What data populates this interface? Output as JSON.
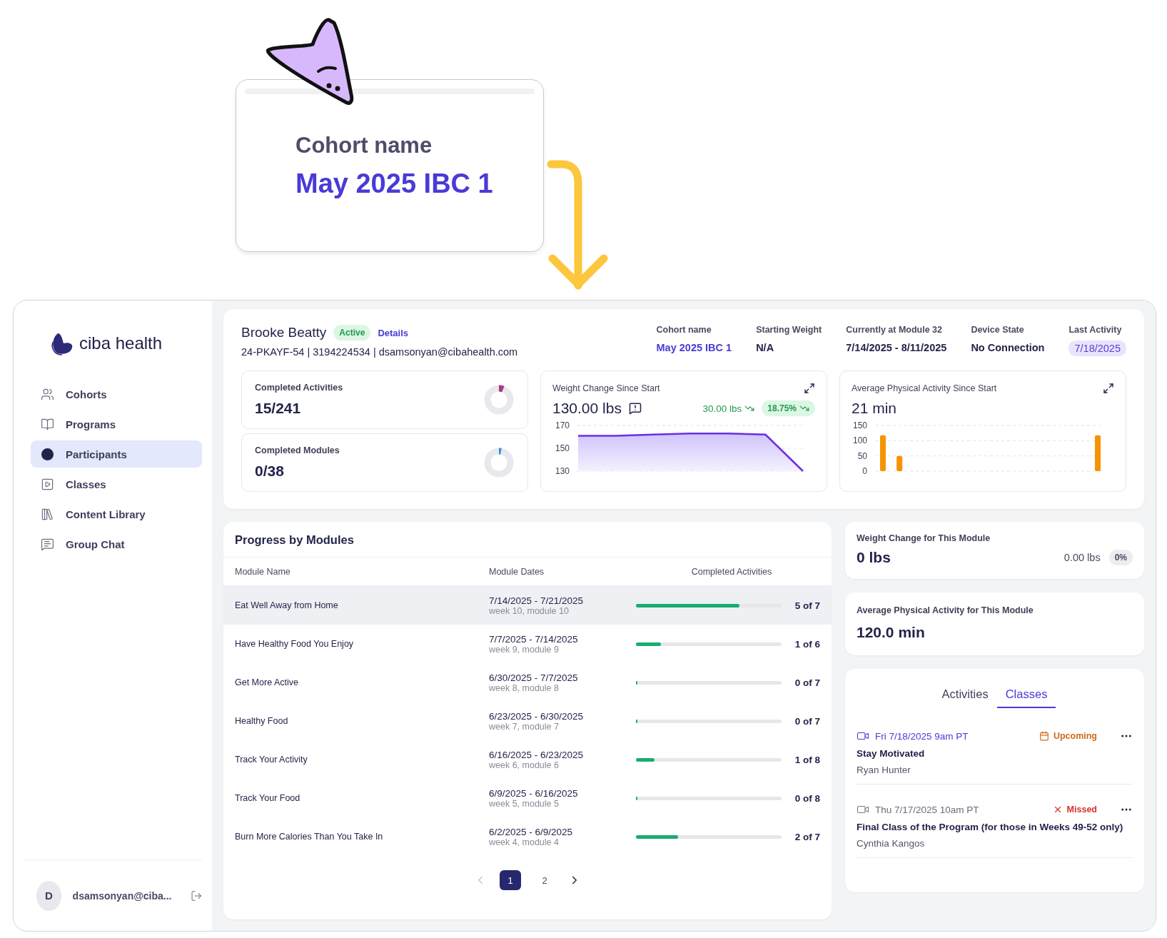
{
  "callout": {
    "label": "Cohort name",
    "value": "May 2025 IBC 1"
  },
  "sidebar": {
    "logo": "ciba health",
    "items": [
      {
        "label": "Cohorts",
        "selected": false
      },
      {
        "label": "Programs",
        "selected": false
      },
      {
        "label": "Participants",
        "selected": true
      },
      {
        "label": "Classes",
        "selected": false
      },
      {
        "label": "Content Library",
        "selected": false
      },
      {
        "label": "Group Chat",
        "selected": false
      }
    ],
    "user": {
      "initial": "D",
      "email": "dsamsonyan@ciba..."
    }
  },
  "participant": {
    "name": "Brooke Beatty",
    "status": "Active",
    "details_link": "Details",
    "info": "24-PKAYF-54 | 3194224534 | dsamsonyan@cibahealth.com"
  },
  "facts": [
    {
      "label": "Cohort name",
      "value": "May 2025 IBC 1",
      "kind": "link"
    },
    {
      "label": "Starting Weight",
      "value": "N/A",
      "kind": "text"
    },
    {
      "label": "Currently at Module 32",
      "value": "7/14/2025 - 8/11/2025",
      "kind": "text"
    },
    {
      "label": "Device State",
      "value": "No Connection",
      "kind": "text"
    },
    {
      "label": "Last Activity",
      "value": "7/18/2025",
      "kind": "badge"
    }
  ],
  "stats": [
    {
      "label": "Completed Activities",
      "value": "15/241",
      "level": 0.06,
      "color": "#b0358f"
    },
    {
      "label": "Completed Modules",
      "value": "0/38",
      "level": 0.01,
      "color": "#3a8fd6"
    }
  ],
  "weight_chart": {
    "title": "Weight Change Since Start",
    "value": "130.00 lbs",
    "change": "30.00 lbs",
    "percent": "18.75%",
    "chart_data": {
      "type": "area",
      "values": [
        161,
        161,
        162,
        163,
        163,
        162,
        130
      ],
      "ylim": [
        130,
        170
      ],
      "yticks": [
        130,
        150,
        170
      ]
    }
  },
  "activity_chart": {
    "title": "Average Physical Activity Since Start",
    "value": "21 min",
    "chart_data": {
      "type": "bar",
      "values": [
        118,
        50,
        0,
        0,
        0,
        0,
        0,
        0,
        0,
        0,
        0,
        0,
        0,
        118
      ],
      "ylim": [
        0,
        150
      ],
      "yticks": [
        0,
        50,
        100,
        150
      ]
    }
  },
  "modules": {
    "title": "Progress by Modules",
    "columns": [
      "Module Name",
      "Module Dates",
      "Completed Activities"
    ],
    "rows": [
      {
        "name": "Eat Well Away from Home",
        "dates": "7/14/2025 - 7/21/2025",
        "week": "week 10, module 10",
        "level": 0.71,
        "count": "5 of 7",
        "selected": true
      },
      {
        "name": "Have Healthy Food You Enjoy",
        "dates": "7/7/2025 - 7/14/2025",
        "week": "week 9, module 9",
        "level": 0.17,
        "count": "1 of 6",
        "selected": false
      },
      {
        "name": "Get More Active",
        "dates": "6/30/2025 - 7/7/2025",
        "week": "week 8, module 8",
        "level": 0,
        "count": "0 of 7",
        "selected": false
      },
      {
        "name": "Healthy Food",
        "dates": "6/23/2025 - 6/30/2025",
        "week": "week 7, module 7",
        "level": 0,
        "count": "0 of 7",
        "selected": false
      },
      {
        "name": "Track Your Activity",
        "dates": "6/16/2025 - 6/23/2025",
        "week": "week 6, module 6",
        "level": 0.125,
        "count": "1 of 8",
        "selected": false
      },
      {
        "name": "Track Your Food",
        "dates": "6/9/2025 - 6/16/2025",
        "week": "week 5, module 5",
        "level": 0,
        "count": "0 of 8",
        "selected": false
      },
      {
        "name": "Burn More Calories Than You Take In",
        "dates": "6/2/2025 - 6/9/2025",
        "week": "week 4, module 4",
        "level": 0.29,
        "count": "2 of 7",
        "selected": false
      }
    ],
    "pages": [
      {
        "label": "1",
        "selected": true
      },
      {
        "label": "2",
        "selected": false
      }
    ]
  },
  "module_weight": {
    "title": "Weight Change for This Module",
    "value": "0 lbs",
    "change": "0.00 lbs",
    "percent": "0%"
  },
  "module_activity": {
    "title": "Average Physical Activity for This Module",
    "value": "120.0 min"
  },
  "classes_panel": {
    "tabs": [
      {
        "label": "Activities",
        "selected": false
      },
      {
        "label": "Classes",
        "selected": true
      }
    ],
    "items": [
      {
        "date": "Fri 7/18/2025 9am PT",
        "status": "Upcoming",
        "kind": "upcoming",
        "title": "Stay Motivated",
        "coach": "Ryan Hunter"
      },
      {
        "date": "Thu 7/17/2025 10am PT",
        "status": "Missed",
        "kind": "missed",
        "title": "Final Class of the Program (for those in Weeks 49-52 only)",
        "coach": "Cynthia Kangos"
      }
    ]
  }
}
